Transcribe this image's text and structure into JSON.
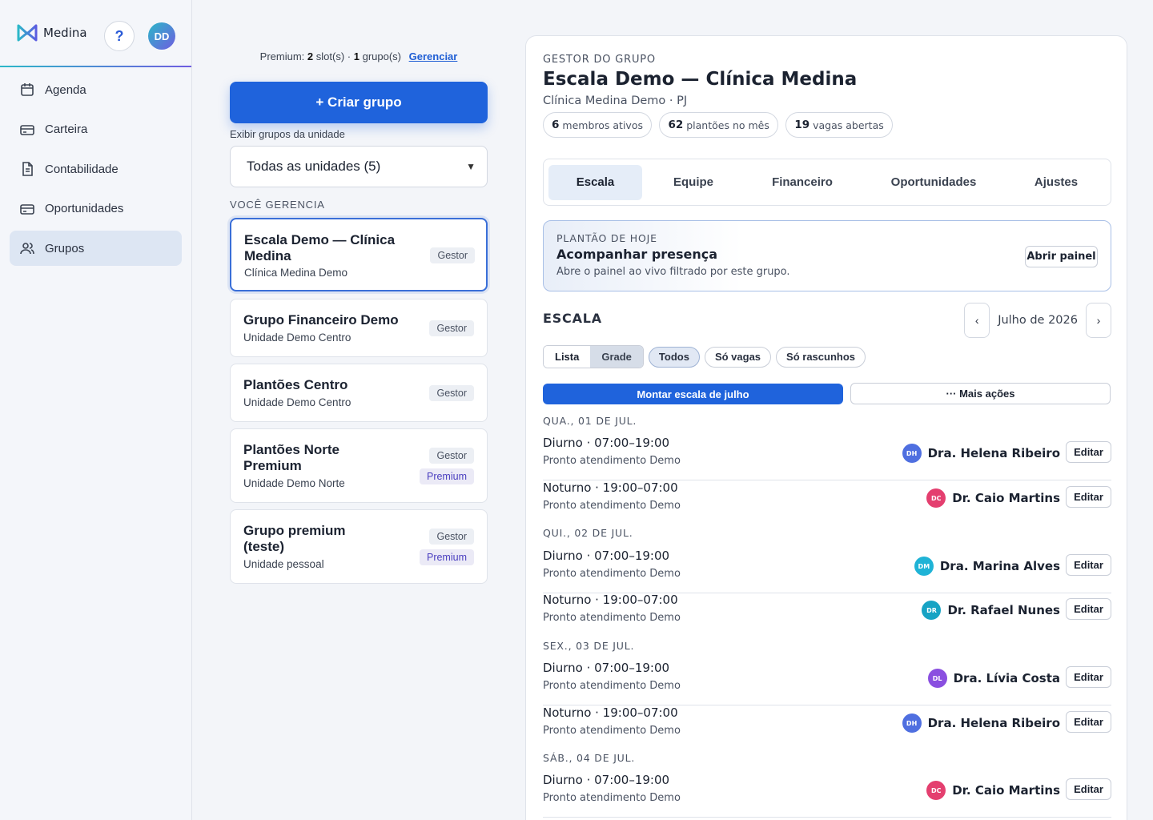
{
  "app": {
    "name": "Medina",
    "help_label": "?",
    "avatar_initials": "DD"
  },
  "sidebar": {
    "items": [
      {
        "label": "Agenda",
        "icon": "calendar-icon"
      },
      {
        "label": "Carteira",
        "icon": "wallet-icon"
      },
      {
        "label": "Contabilidade",
        "icon": "document-icon"
      },
      {
        "label": "Oportunidades",
        "icon": "card-icon"
      },
      {
        "label": "Grupos",
        "icon": "users-icon",
        "active": true
      }
    ]
  },
  "groups_column": {
    "premium_prefix": "Premium:",
    "slots_count": "2",
    "slots_text": "slot(s) ·",
    "groups_count": "1",
    "groups_text": "grupo(s)",
    "manage_link": "Gerenciar",
    "create_button": "+ Criar grupo",
    "unit_filter_label": "Exibir grupos da unidade",
    "unit_filter_value": "Todas as unidades (5)",
    "section_title": "VOCÊ GERENCIA",
    "groups": [
      {
        "name": "Escala Demo — Clínica Medina",
        "unit": "Clínica Medina Demo",
        "role": "Gestor",
        "premium": ""
      },
      {
        "name": "Grupo Financeiro Demo",
        "unit": "Unidade Demo Centro",
        "role": "Gestor",
        "premium": ""
      },
      {
        "name": "Plantões Centro",
        "unit": "Unidade Demo Centro",
        "role": "Gestor",
        "premium": ""
      },
      {
        "name": "Plantões Norte Premium",
        "unit": "Unidade Demo Norte",
        "role": "Gestor",
        "premium": "Premium"
      },
      {
        "name": "Grupo premium (teste)",
        "unit": "Unidade pessoal",
        "role": "Gestor",
        "premium": "Premium"
      }
    ]
  },
  "detail": {
    "eyebrow": "GESTOR DO GRUPO",
    "title": "Escala Demo — Clínica Medina",
    "subtitle": "Clínica Medina Demo · PJ",
    "stats": [
      {
        "value": "6",
        "label": "membros ativos"
      },
      {
        "value": "62",
        "label": "plantões no mês"
      },
      {
        "value": "19",
        "label": "vagas abertas"
      }
    ],
    "tabs": [
      "Escala",
      "Equipe",
      "Financeiro",
      "Oportunidades",
      "Ajustes"
    ],
    "today": {
      "eyebrow": "PLANTÃO DE HOJE",
      "title": "Acompanhar presença",
      "desc": "Abre o painel ao vivo filtrado por este grupo.",
      "button": "Abrir painel"
    },
    "schedule_title": "ESCALA",
    "month": "Julho de 2026",
    "prev": "‹",
    "next": "›",
    "view_toggle": [
      "Lista",
      "Grade"
    ],
    "filters": [
      "Todos",
      "Só vagas",
      "Só rascunhos"
    ],
    "build_button": "Montar escala de julho",
    "more_button": "··· Mais ações",
    "edit_label": "Editar",
    "days": [
      {
        "header": "QUA., 01 DE JUL.",
        "shifts": [
          {
            "time": "Diurno · 07:00–19:00",
            "loc": "Pronto atendimento Demo",
            "doctor": "Dra. Helena Ribeiro",
            "initials": "DH",
            "color": "#4f6fe0"
          },
          {
            "time": "Noturno · 19:00–07:00",
            "loc": "Pronto atendimento Demo",
            "doctor": "Dr. Caio Martins",
            "initials": "DC",
            "color": "#e43f6f"
          }
        ]
      },
      {
        "header": "QUI., 02 DE JUL.",
        "shifts": [
          {
            "time": "Diurno · 07:00–19:00",
            "loc": "Pronto atendimento Demo",
            "doctor": "Dra. Marina Alves",
            "initials": "DM",
            "color": "#1fb3d6"
          },
          {
            "time": "Noturno · 19:00–07:00",
            "loc": "Pronto atendimento Demo",
            "doctor": "Dr. Rafael Nunes",
            "initials": "DR",
            "color": "#17a3c4"
          }
        ]
      },
      {
        "header": "SEX., 03 DE JUL.",
        "shifts": [
          {
            "time": "Diurno · 07:00–19:00",
            "loc": "Pronto atendimento Demo",
            "doctor": "Dra. Lívia Costa",
            "initials": "DL",
            "color": "#8a4fe0"
          },
          {
            "time": "Noturno · 19:00–07:00",
            "loc": "Pronto atendimento Demo",
            "doctor": "Dra. Helena Ribeiro",
            "initials": "DH",
            "color": "#4f6fe0"
          }
        ]
      },
      {
        "header": "SÁB., 04 DE JUL.",
        "shifts": [
          {
            "time": "Diurno · 07:00–19:00",
            "loc": "Pronto atendimento Demo",
            "doctor": "Dr. Caio Martins",
            "initials": "DC",
            "color": "#e43f6f"
          }
        ]
      }
    ]
  }
}
